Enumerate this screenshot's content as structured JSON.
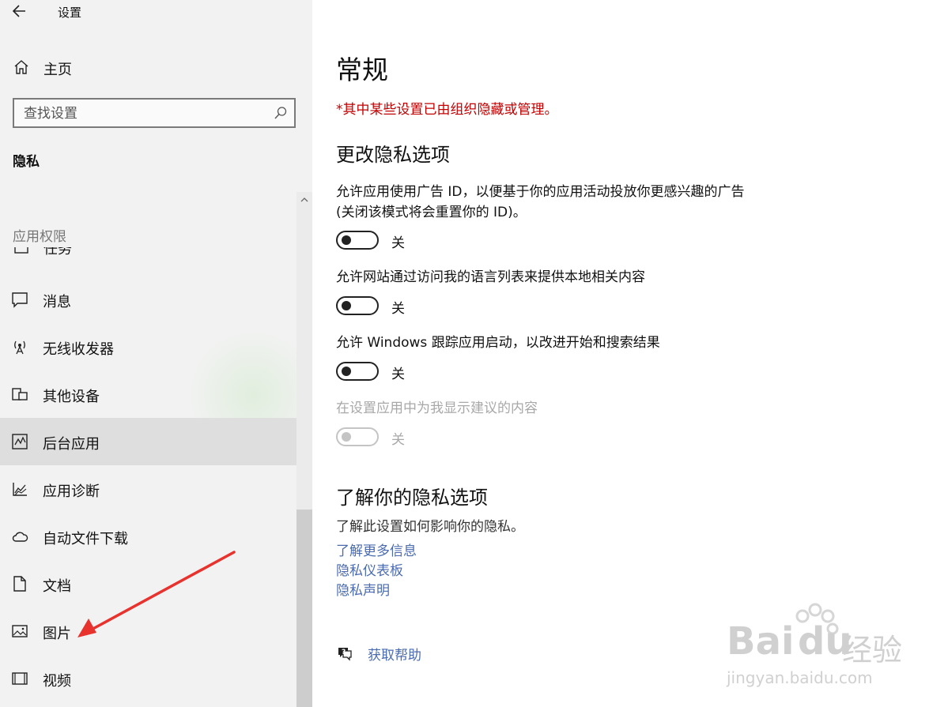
{
  "window": {
    "title": "设置"
  },
  "sidebar": {
    "home_label": "主页",
    "search_placeholder": "查找设置",
    "section_title": "隐私",
    "group_header": "应用权限",
    "partial_item_label": "任务",
    "items": [
      {
        "label": "消息",
        "icon": "message-icon"
      },
      {
        "label": "无线收发器",
        "icon": "radio-icon"
      },
      {
        "label": "其他设备",
        "icon": "devices-icon"
      },
      {
        "label": "后台应用",
        "icon": "background-apps-icon",
        "selected": true
      },
      {
        "label": "应用诊断",
        "icon": "diagnostics-icon"
      },
      {
        "label": "自动文件下载",
        "icon": "cloud-icon"
      },
      {
        "label": "文档",
        "icon": "document-icon"
      },
      {
        "label": "图片",
        "icon": "picture-icon"
      },
      {
        "label": "视频",
        "icon": "video-icon"
      }
    ]
  },
  "main": {
    "title": "常规",
    "managed_note": "*其中某些设置已由组织隐藏或管理。",
    "change_heading": "更改隐私选项",
    "settings": [
      {
        "desc_line1": "允许应用使用广告 ID，以便基于你的应用活动投放你更感兴趣的广告",
        "desc_line2": "(关闭该模式将会重置你的 ID)。",
        "state": "关",
        "enabled": true
      },
      {
        "desc_line1": "允许网站通过访问我的语言列表来提供本地相关内容",
        "state": "关",
        "enabled": true
      },
      {
        "desc_line1": "允许 Windows 跟踪应用启动，以改进开始和搜索结果",
        "state": "关",
        "enabled": true
      },
      {
        "desc_line1": "在设置应用中为我显示建议的内容",
        "state": "关",
        "enabled": false
      }
    ],
    "learn_heading": "了解你的隐私选项",
    "learn_desc": "了解此设置如何影响你的隐私。",
    "links": [
      "了解更多信息",
      "隐私仪表板",
      "隐私声明"
    ],
    "help_label": "获取帮助"
  },
  "watermark": {
    "brand": "Bai",
    "brand2": "du",
    "cn": "经验",
    "url": "jingyan.baidu.com"
  },
  "colors": {
    "managed_note": "#c00000",
    "link": "#4a6bb0",
    "selected_bg": "#dedede",
    "annotation_arrow": "#e8322e"
  }
}
